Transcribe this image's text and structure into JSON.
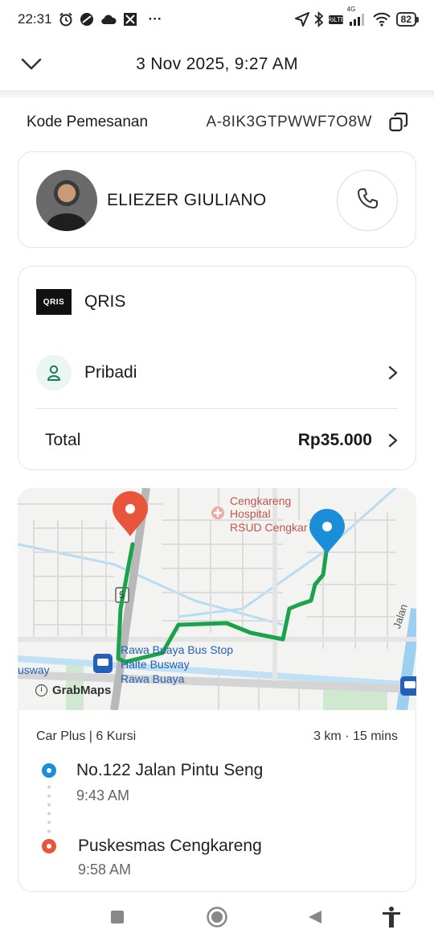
{
  "status_bar": {
    "time": "22:31",
    "dots": "···",
    "battery": "82",
    "network": "4G",
    "volte": "VoLTE"
  },
  "header": {
    "title": "3 Nov 2025, 9:27 AM"
  },
  "booking": {
    "label": "Kode Pemesanan",
    "code": "A-8IK3GTPWWF7O8W"
  },
  "driver": {
    "name": "ELIEZER GIULIANO"
  },
  "payment": {
    "method_logo": "QRIS",
    "method": "QRIS",
    "profile": "Pribadi",
    "total_label": "Total",
    "total_value": "Rp35.000"
  },
  "map": {
    "labels": {
      "hospital_line1": "Cengkareng",
      "hospital_line2": "Hospital",
      "hospital_line3": "RSUD Cengkar",
      "bus_stop_line1": "Rawa Buaya Bus Stop",
      "bus_stop_line2": "Halte Busway",
      "bus_stop_line3": "Rawa Buaya",
      "busway": "usway",
      "road_badge": "5",
      "jalan": "Jalan",
      "brand": "GrabMaps"
    },
    "colors": {
      "route": "#1aa34a",
      "pickup_pin": "#1a8fd8",
      "dropoff_pin": "#e8553a"
    }
  },
  "trip": {
    "vehicle": "Car Plus | 6 Kursi",
    "distance": "3 km · 15 mins",
    "pickup": {
      "name": "No.122 Jalan Pintu Seng",
      "time": "9:43 AM"
    },
    "dropoff": {
      "name": "Puskesmas Cengkareng",
      "time": "9:58 AM"
    }
  },
  "colors": {
    "accent_green": "#1aa34a",
    "pickup_blue": "#1a8fd8",
    "dropoff_red": "#e8553a"
  }
}
